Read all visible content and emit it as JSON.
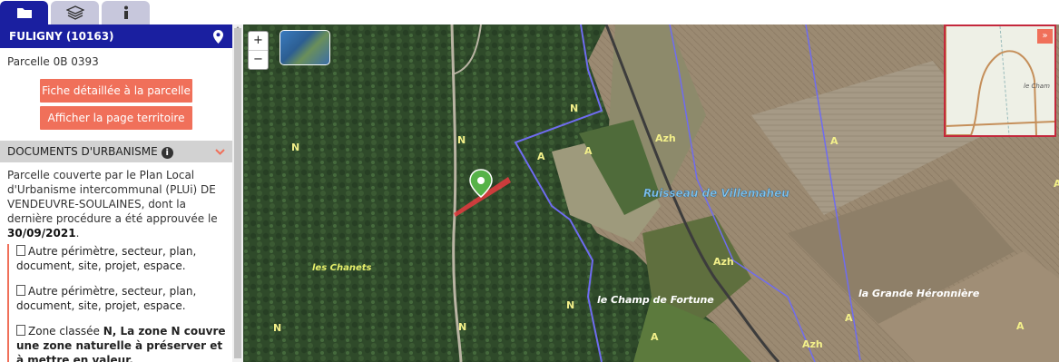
{
  "tabs": [
    {
      "icon": "folder-icon",
      "active": true
    },
    {
      "icon": "layers-icon",
      "active": false
    },
    {
      "icon": "info-icon",
      "active": false
    }
  ],
  "panel": {
    "title": "FULIGNY (10163)",
    "parcel": "Parcelle 0B 0393",
    "btn_fiche": "Fiche détaillée à la parcelle",
    "btn_territoire": "Afficher la page territoire",
    "section_title": "DOCUMENTS D'URBANISME",
    "desc_pre": "Parcelle couverte par le Plan Local d'Urbanisme intercommunal (PLUi) DE VENDEUVRE-SOULAINES, dont la dernière procédure a été approuvée le ",
    "desc_date": "30/09/2021",
    "desc_post": ".",
    "item1": "Autre périmètre, secteur, plan, document, site, projet, espace.",
    "item2": "Autre périmètre, secteur, plan, document, site, projet, espace.",
    "item3_pre": "Zone classée ",
    "item3_bold": "N, La zone N couvre une zone naturelle à préserver et à mettre en valeur."
  },
  "map": {
    "zoom_in": "+",
    "zoom_out": "−",
    "minimap_close": "»",
    "minimap_label": "le Cham",
    "labels": {
      "ruisseau": "Ruisseau de Villemaheu",
      "chanets": "les Chanets",
      "champ": "le Champ de Fortune",
      "heronniere": "la Grande Héronnière",
      "n": "N",
      "a": "A",
      "azh": "Azh"
    }
  },
  "colors": {
    "brand": "#1a1fa0",
    "accent": "#f0705a",
    "zone_border": "#6f6cf0"
  }
}
